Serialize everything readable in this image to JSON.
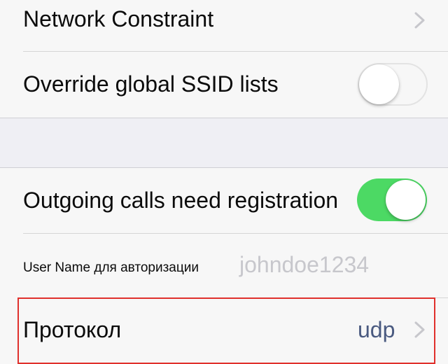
{
  "rows": {
    "network_constraint": {
      "label": "Network Constraint",
      "chevron_icon": "chevron-right-icon"
    },
    "override_ssid": {
      "label": "Override global SSID lists",
      "toggle_state": "off"
    },
    "outgoing_calls": {
      "label": "Outgoing calls need registration",
      "toggle_state": "on"
    },
    "auth_username": {
      "label": "User Name для авторизации",
      "placeholder": "johndoe1234"
    },
    "protocol": {
      "label": "Протокол",
      "value": "udp",
      "chevron_icon": "chevron-right-icon"
    }
  },
  "colors": {
    "toggle_on": "#4cd964",
    "value_text": "#4a5a80",
    "placeholder_text": "#c7c7cc",
    "highlight_border": "#e0302c",
    "group_background": "#efeff4"
  }
}
